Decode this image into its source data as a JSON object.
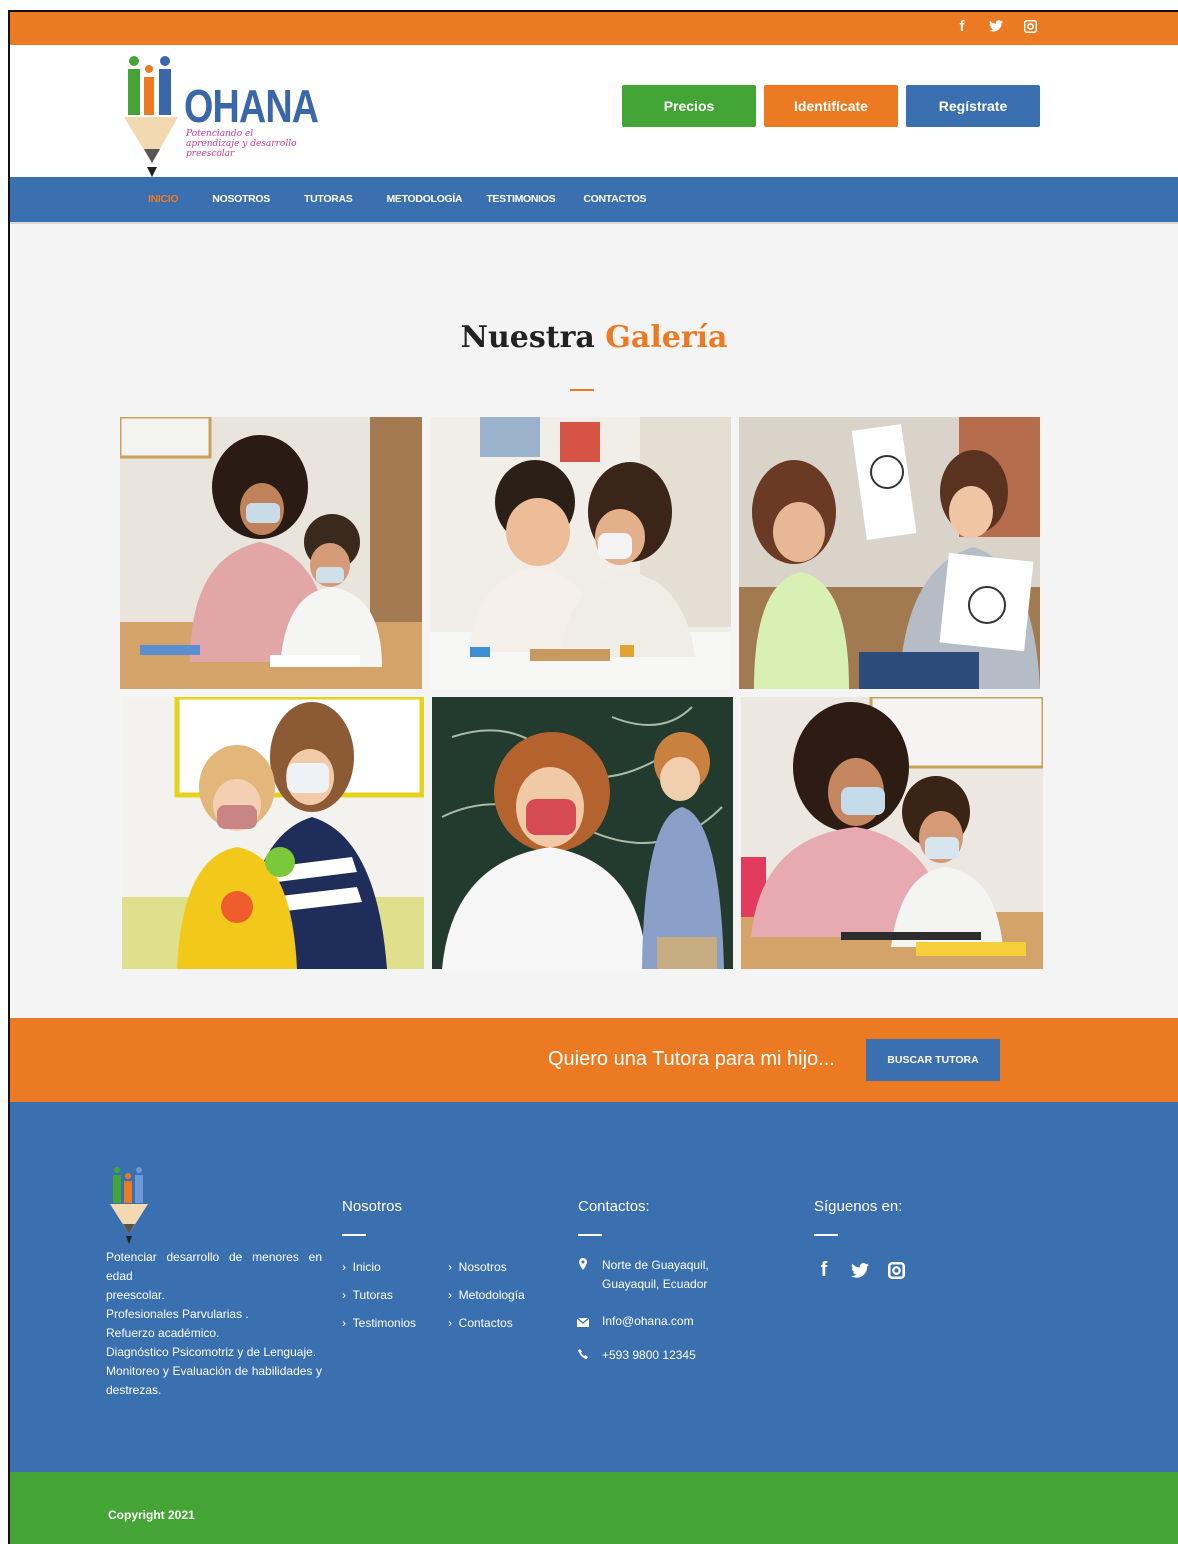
{
  "social": [
    "f",
    "t",
    "i"
  ],
  "brand": {
    "name": "OHANA",
    "tagline": "Potenciando el aprendizaje y desarrollo preescolar"
  },
  "header_buttons": {
    "prices": "Precios",
    "login": "Identifícate",
    "register": "Regístrate"
  },
  "nav": [
    "INICIO",
    "NOSOTROS",
    "TUTORAS",
    "METODOLOGÍA",
    "TESTIMONIOS",
    "CONTACTOS"
  ],
  "gallery": {
    "title_main": "Nuestra",
    "title_accent": "Galería"
  },
  "cta": {
    "text": "Quiero una Tutora para mi hijo...",
    "button": "BUSCAR TUTORA"
  },
  "footer": {
    "description": [
      "Potenciar desarrollo de menores en edad",
      "preescolar.",
      "Profesionales Parvularias .",
      "Refuerzo académico.",
      "Diagnóstico  Psicomotriz y de Lenguaje.",
      "Monitoreo  y  Evaluación  de  habilidades  y",
      "destrezas."
    ],
    "about_title": "Nosotros",
    "about_links": [
      "Inicio",
      "Tutoras",
      "Testimonios",
      "Nosotros",
      "Metodología",
      "Contactos"
    ],
    "contact_title": "Contactos:",
    "address": [
      "Norte de Guayaquil,",
      "Guayaquil, Ecuador"
    ],
    "email": "Info@ohana.com",
    "phone": "+593 9800 12345",
    "follow_title": "Síguenos en:"
  },
  "copyright": "Copyright 2021",
  "colors": {
    "orange": "#ec7a22",
    "blue": "#3a6fb0",
    "green": "#44a536"
  }
}
